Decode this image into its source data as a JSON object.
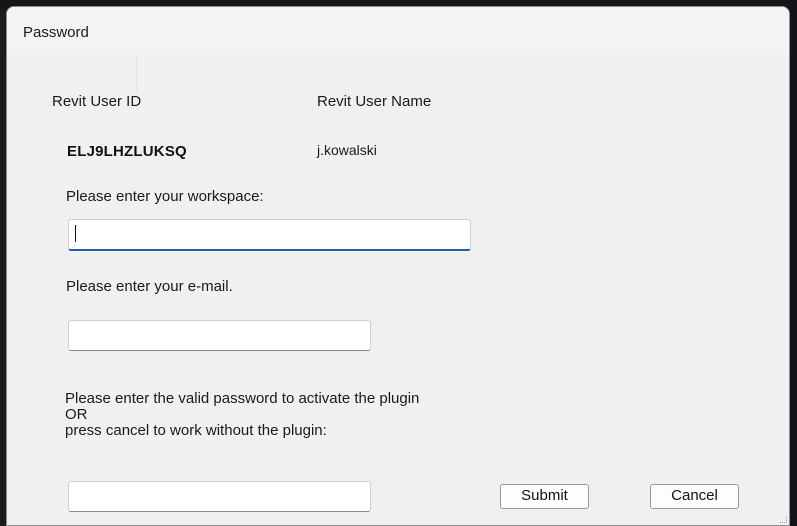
{
  "window": {
    "title": "Password"
  },
  "user_info": {
    "id_header": "Revit User ID",
    "name_header": "Revit User Name",
    "id_value": "ELJ9LHZLUKSQ",
    "name_value": "j.kowalski"
  },
  "workspace": {
    "prompt": "Please enter your workspace:",
    "value": ""
  },
  "email": {
    "prompt": "Please enter your e-mail.",
    "value": ""
  },
  "password": {
    "prompt_line1": "Please enter the valid password to activate the plugin",
    "prompt_line2": "OR",
    "prompt_line3": "press cancel to work without the plugin:",
    "value": ""
  },
  "buttons": {
    "submit_label": "Submit",
    "cancel_label": "Cancel"
  }
}
